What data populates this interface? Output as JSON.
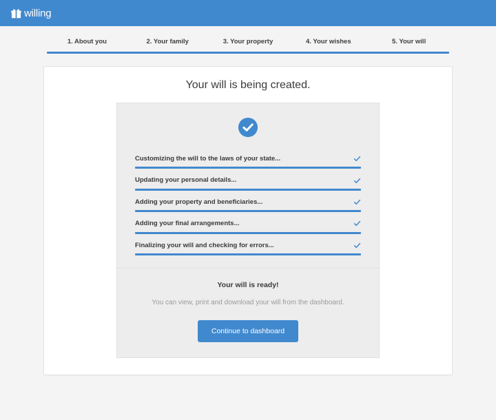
{
  "colors": {
    "brand_blue": "#4189ce",
    "page_background": "#f4f4f4",
    "card_background": "#ffffff",
    "panel_background": "#ededed",
    "muted_text": "#9a9a9a"
  },
  "navbar": {
    "logo_icon": "gift-icon",
    "brand_name": "willing"
  },
  "steps": [
    {
      "label": "1. About you"
    },
    {
      "label": "2. Your family"
    },
    {
      "label": "3. Your property"
    },
    {
      "label": "4. Your wishes"
    },
    {
      "label": "5. Your will"
    }
  ],
  "main": {
    "title": "Your will is being created.",
    "status_icon": "check-circle-icon",
    "tasks": [
      {
        "label": "Customizing the will to the laws of your state...",
        "status_icon": "check-icon"
      },
      {
        "label": "Updating your personal details...",
        "status_icon": "check-icon"
      },
      {
        "label": "Adding your property and beneficiaries...",
        "status_icon": "check-icon"
      },
      {
        "label": "Adding your final arrangements...",
        "status_icon": "check-icon"
      },
      {
        "label": "Finalizing your will and checking for errors...",
        "status_icon": "check-icon"
      }
    ],
    "footer": {
      "ready_title": "Your will is ready!",
      "ready_subtitle": "You can view, print and download your will from the dashboard.",
      "cta_label": "Continue to dashboard"
    }
  }
}
